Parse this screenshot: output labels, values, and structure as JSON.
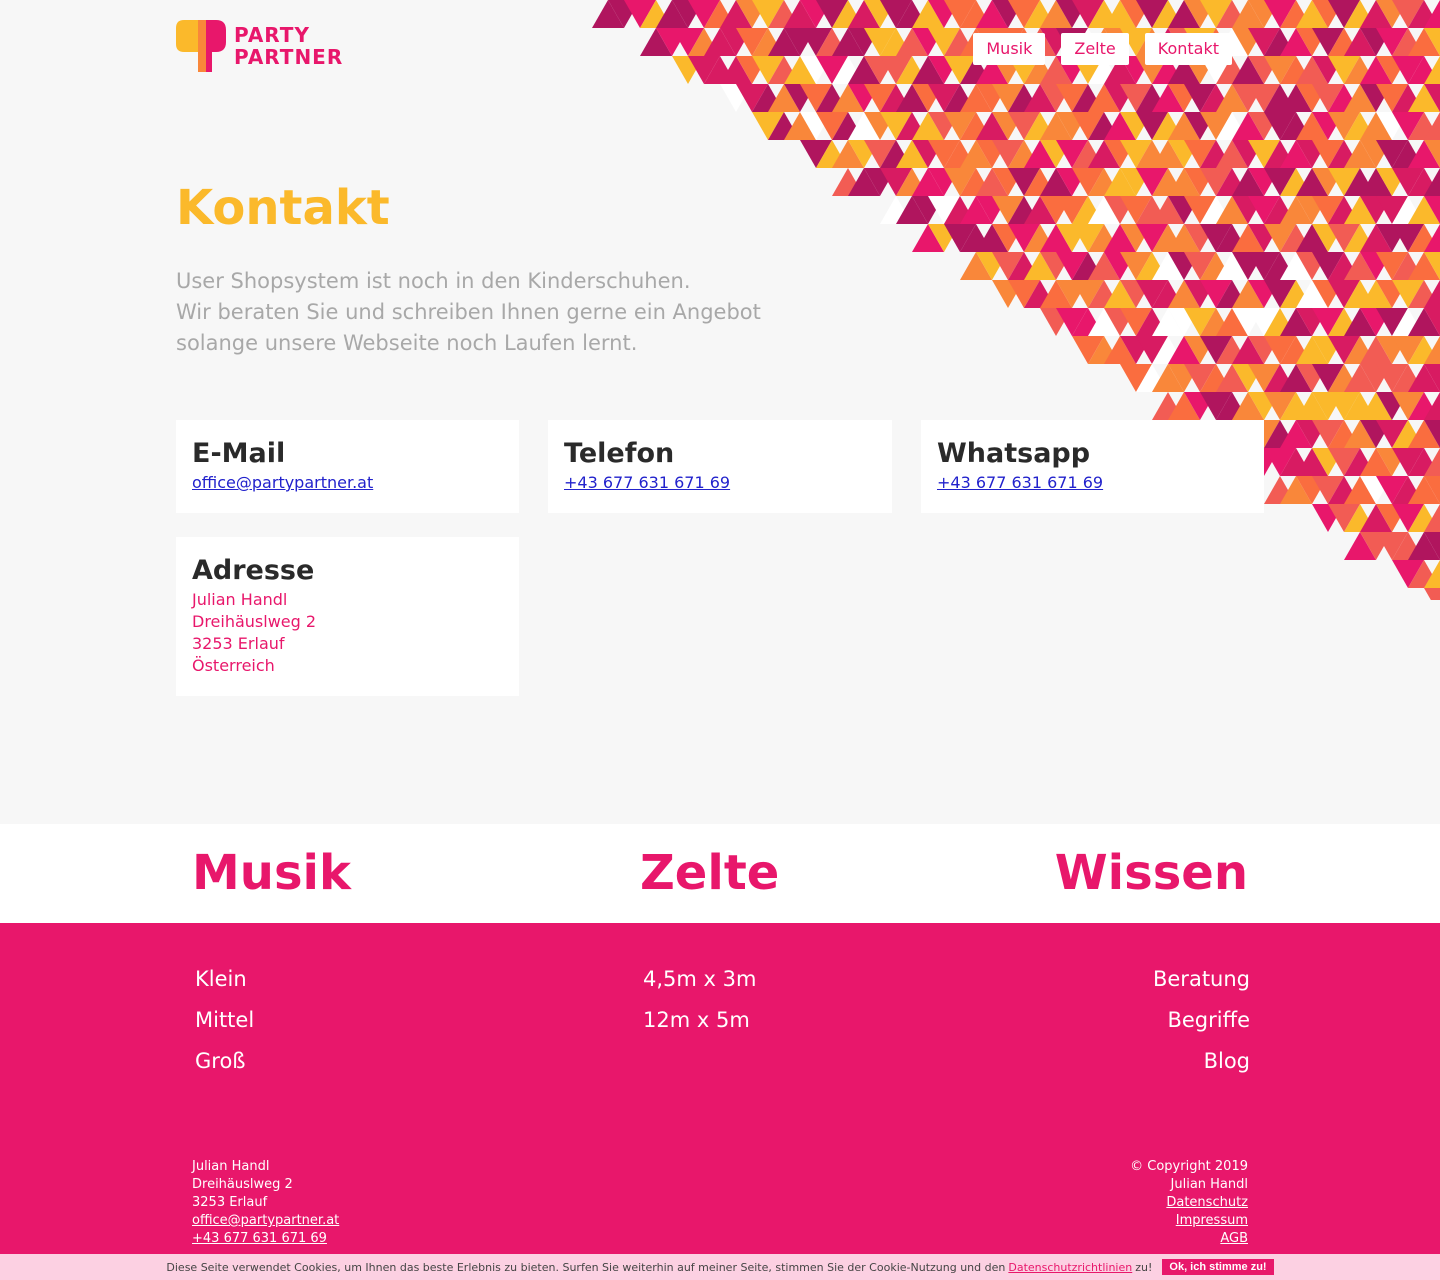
{
  "brand": {
    "line1": "PARTY",
    "line2": "PARTNER",
    "colors": {
      "pink": "#e8176b",
      "yellow": "#fbb92b",
      "orange": "#f9873a",
      "magenta": "#b0155e"
    }
  },
  "nav": {
    "items": [
      {
        "label": "Musik"
      },
      {
        "label": "Zelte"
      },
      {
        "label": "Kontakt"
      }
    ]
  },
  "hero": {
    "title": "Kontakt",
    "intro": [
      "User Shopsystem ist noch in den Kinderschuhen.",
      "Wir beraten Sie und schreiben Ihnen gerne ein Angebot",
      "solange unsere Webseite noch Laufen lernt."
    ]
  },
  "contact": {
    "email": {
      "title": "E-Mail",
      "value": "office@partypartner.at"
    },
    "phone": {
      "title": "Telefon",
      "value": "+43 677 631 671 69"
    },
    "whatsapp": {
      "title": "Whatsapp",
      "value": "+43 677 631 671 69"
    },
    "address": {
      "title": "Adresse",
      "lines": [
        "Julian Handl",
        "Dreihäuslweg 2",
        "3253 Erlauf",
        "Österreich"
      ]
    }
  },
  "categories": {
    "musik": {
      "title": "Musik",
      "links": [
        "Klein",
        "Mittel",
        "Groß"
      ]
    },
    "zelte": {
      "title": "Zelte",
      "links": [
        "4,5m x 3m",
        "12m x 5m"
      ]
    },
    "wissen": {
      "title": "Wissen",
      "links": [
        "Beratung",
        "Begriffe",
        "Blog"
      ]
    }
  },
  "footer": {
    "left": [
      "Julian Handl",
      "Dreihäuslweg 2",
      "3253 Erlauf"
    ],
    "left_email": "office@partypartner.at",
    "left_phone": "+43 677 631 671 69",
    "copyright": "© Copyright 2019",
    "owner": "Julian Handl",
    "links": [
      "Datenschutz",
      "Impressum",
      "AGB"
    ]
  },
  "cookie": {
    "text": "Diese Seite verwendet Cookies, um Ihnen das beste Erlebnis zu bieten. Surfen Sie weiterhin auf meiner Seite, stimmen Sie der Cookie-Nutzung und den",
    "link": "Datenschutzrichtlinien",
    "suffix": "zu!",
    "button": "Ok, ich stimme zu!"
  }
}
